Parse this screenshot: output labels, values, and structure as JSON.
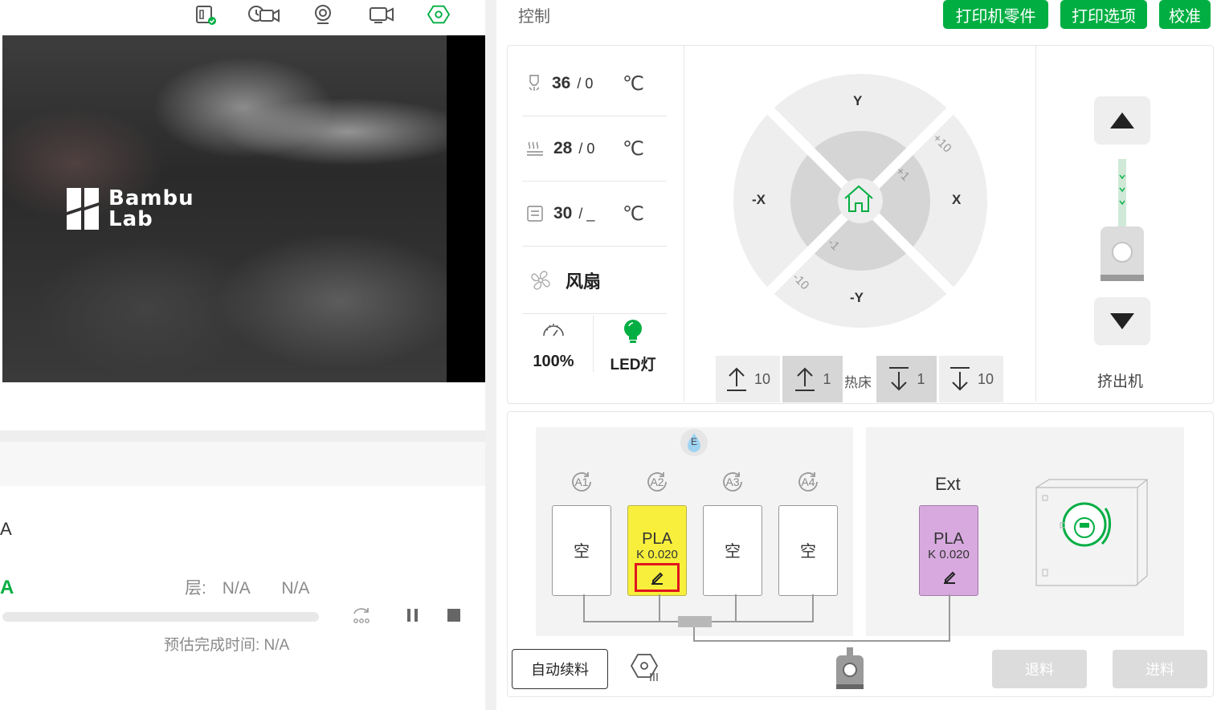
{
  "colors": {
    "accent": "#00ae42",
    "pla_yellow": "#f7ef3c",
    "pla_purple": "#d7a9de"
  },
  "top_icons": [
    "sd-card-icon",
    "timelapse-icon",
    "webcam-icon",
    "video-icon",
    "settings-hex-icon"
  ],
  "camera": {
    "logo_line1": "Bambu",
    "logo_line2": "Lab"
  },
  "task": {
    "name": "A",
    "status": "A",
    "layer_label": "层:",
    "layer_value1": "N/A",
    "layer_value2": "N/A",
    "eta": "预估完成时间: N/A",
    "progress": 0
  },
  "header": {
    "title": "控制",
    "btn_parts": "打印机零件",
    "btn_options": "打印选项",
    "btn_calibrate": "校准"
  },
  "temps": {
    "nozzle": {
      "current": "36",
      "target": "/ 0",
      "unit": "℃"
    },
    "bed": {
      "current": "28",
      "target": "/ 0",
      "unit": "℃"
    },
    "chamber": {
      "current": "30",
      "target": "/ _",
      "unit": "℃"
    },
    "fan_label": "风扇",
    "speed": "100%",
    "led": "LED灯"
  },
  "jog": {
    "y_plus": "Y",
    "y_minus": "-Y",
    "x_plus": "X",
    "x_minus": "-X",
    "plus10": "+10",
    "plus1": "+1",
    "minus1": "-1",
    "minus10": "-10"
  },
  "bed_controls": {
    "up10": "10",
    "up1": "1",
    "label": "热床",
    "down1": "1",
    "down10": "10"
  },
  "extruder": {
    "label": "挤出机"
  },
  "ams": {
    "hub_badge": "E",
    "slots": [
      {
        "id": "A1",
        "label": "空"
      },
      {
        "id": "A2",
        "material": "PLA",
        "k": "K 0.020"
      },
      {
        "id": "A3",
        "label": "空"
      },
      {
        "id": "A4",
        "label": "空"
      }
    ],
    "ext": {
      "title": "Ext",
      "material": "PLA",
      "k": "K 0.020"
    }
  },
  "bottom": {
    "auto_refill": "自动续料",
    "unload": "退料",
    "load": "进料"
  }
}
